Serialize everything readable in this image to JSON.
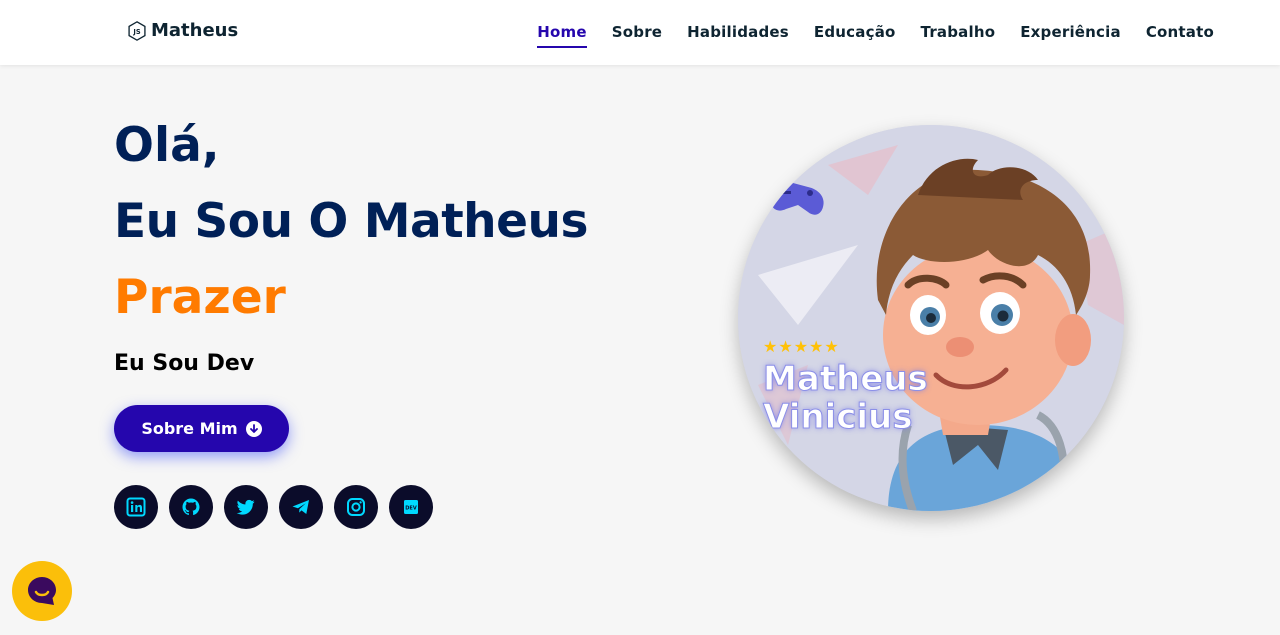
{
  "nav": {
    "brand": "Matheus",
    "links": [
      {
        "label": "Home",
        "active": true
      },
      {
        "label": "Sobre",
        "active": false
      },
      {
        "label": "Habilidades",
        "active": false
      },
      {
        "label": "Educação",
        "active": false
      },
      {
        "label": "Trabalho",
        "active": false
      },
      {
        "label": "Experiência",
        "active": false
      },
      {
        "label": "Contato",
        "active": false
      }
    ]
  },
  "hero": {
    "line1": "Olá,",
    "line2": "Eu Sou O Matheus",
    "line3": "Prazer",
    "subtitle": "Eu Sou Dev",
    "button_label": "Sobre Mim",
    "socials": [
      {
        "icon": "linkedin-icon"
      },
      {
        "icon": "github-icon"
      },
      {
        "icon": "twitter-icon"
      },
      {
        "icon": "telegram-icon"
      },
      {
        "icon": "instagram-icon"
      },
      {
        "icon": "dev-icon",
        "label": "DEV"
      }
    ]
  },
  "avatar": {
    "name_line1": "Matheus",
    "name_line2": "Vinicius",
    "rating": "★★★★★"
  },
  "colors": {
    "primary": "#2506ad",
    "heading": "#002057",
    "accent": "#ff7b00",
    "social_bg": "#0b0c2a",
    "social_icon": "#00d9ff",
    "chat_bg": "#fbbf0a",
    "chat_icon": "#3a0a5e"
  }
}
